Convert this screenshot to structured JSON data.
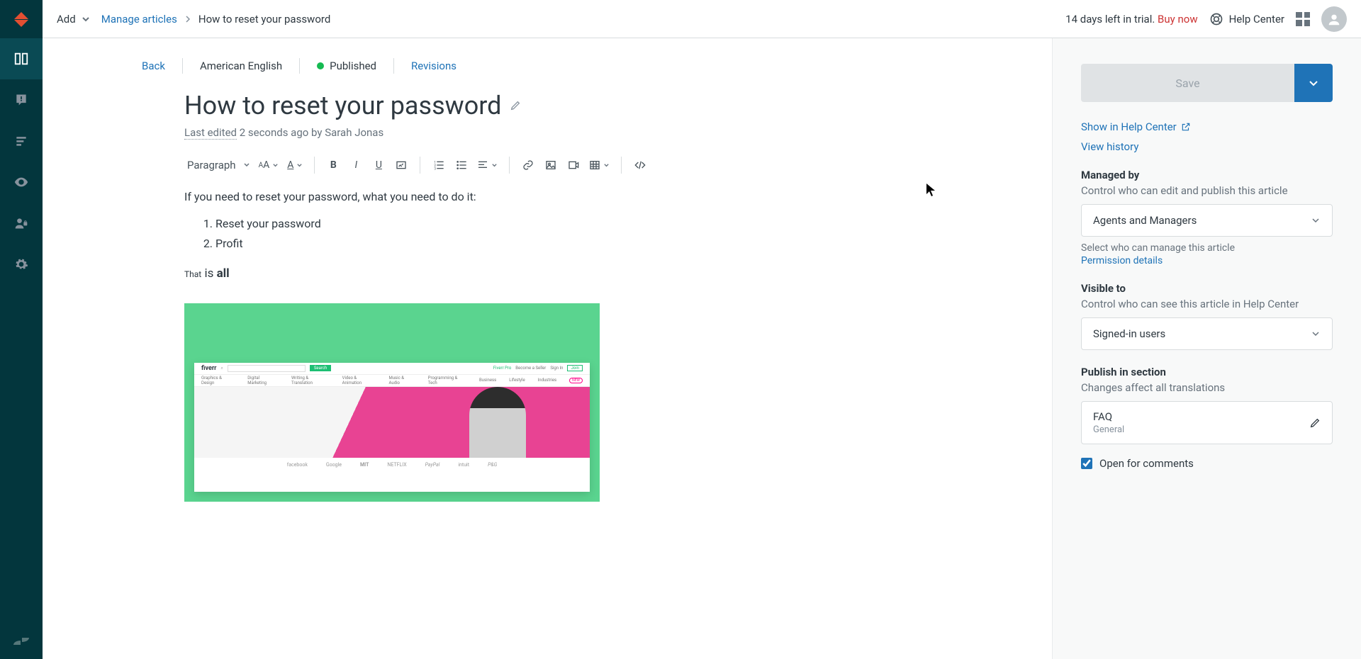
{
  "topbar": {
    "add_label": "Add",
    "breadcrumb_link": "Manage articles",
    "breadcrumb_current": "How to reset your password",
    "trial_text": "14 days left in trial. ",
    "buy_now": "Buy now",
    "help_center": "Help Center"
  },
  "editor_header": {
    "back": "Back",
    "language": "American English",
    "status": "Published",
    "revisions": "Revisions"
  },
  "article": {
    "title": "How to reset your password",
    "last_edited_label": "Last edited",
    "last_edited_rest": " 2 seconds ago by Sarah Jonas",
    "intro": "If you need to reset your password, what you need to do it:",
    "steps": [
      "Reset your password",
      "Profit"
    ],
    "final_small": "That",
    "final_mid": " is ",
    "final_bold": "all"
  },
  "toolbar": {
    "paragraph": "Paragraph"
  },
  "embed": {
    "brand": "fiverr",
    "search_btn": "Search",
    "right_links": [
      "Fiverr Pro",
      "Become a Seller",
      "Sign In",
      "Join"
    ],
    "nav": [
      "Graphics & Design",
      "Digital Marketing",
      "Writing & Translation",
      "Video & Animation",
      "Music & Audio",
      "Programming & Tech",
      "Business",
      "Lifestyle",
      "Industries"
    ],
    "nav_badge": "NEW",
    "logos": [
      "facebook",
      "Google",
      "MIT",
      "NETFLIX",
      "PayPal",
      "intuit",
      "P&G"
    ]
  },
  "sidepanel": {
    "save": "Save",
    "show_in_hc": "Show in Help Center",
    "view_history": "View history",
    "managed_by": {
      "title": "Managed by",
      "desc": "Control who can edit and publish this article",
      "value": "Agents and Managers",
      "helper": "Select who can manage this article",
      "link": "Permission details"
    },
    "visible_to": {
      "title": "Visible to",
      "desc": "Control who can see this article in Help Center",
      "value": "Signed-in users"
    },
    "publish_in": {
      "title": "Publish in section",
      "desc": "Changes affect all translations",
      "value": "FAQ",
      "sub": "General"
    },
    "open_comments": "Open for comments"
  }
}
